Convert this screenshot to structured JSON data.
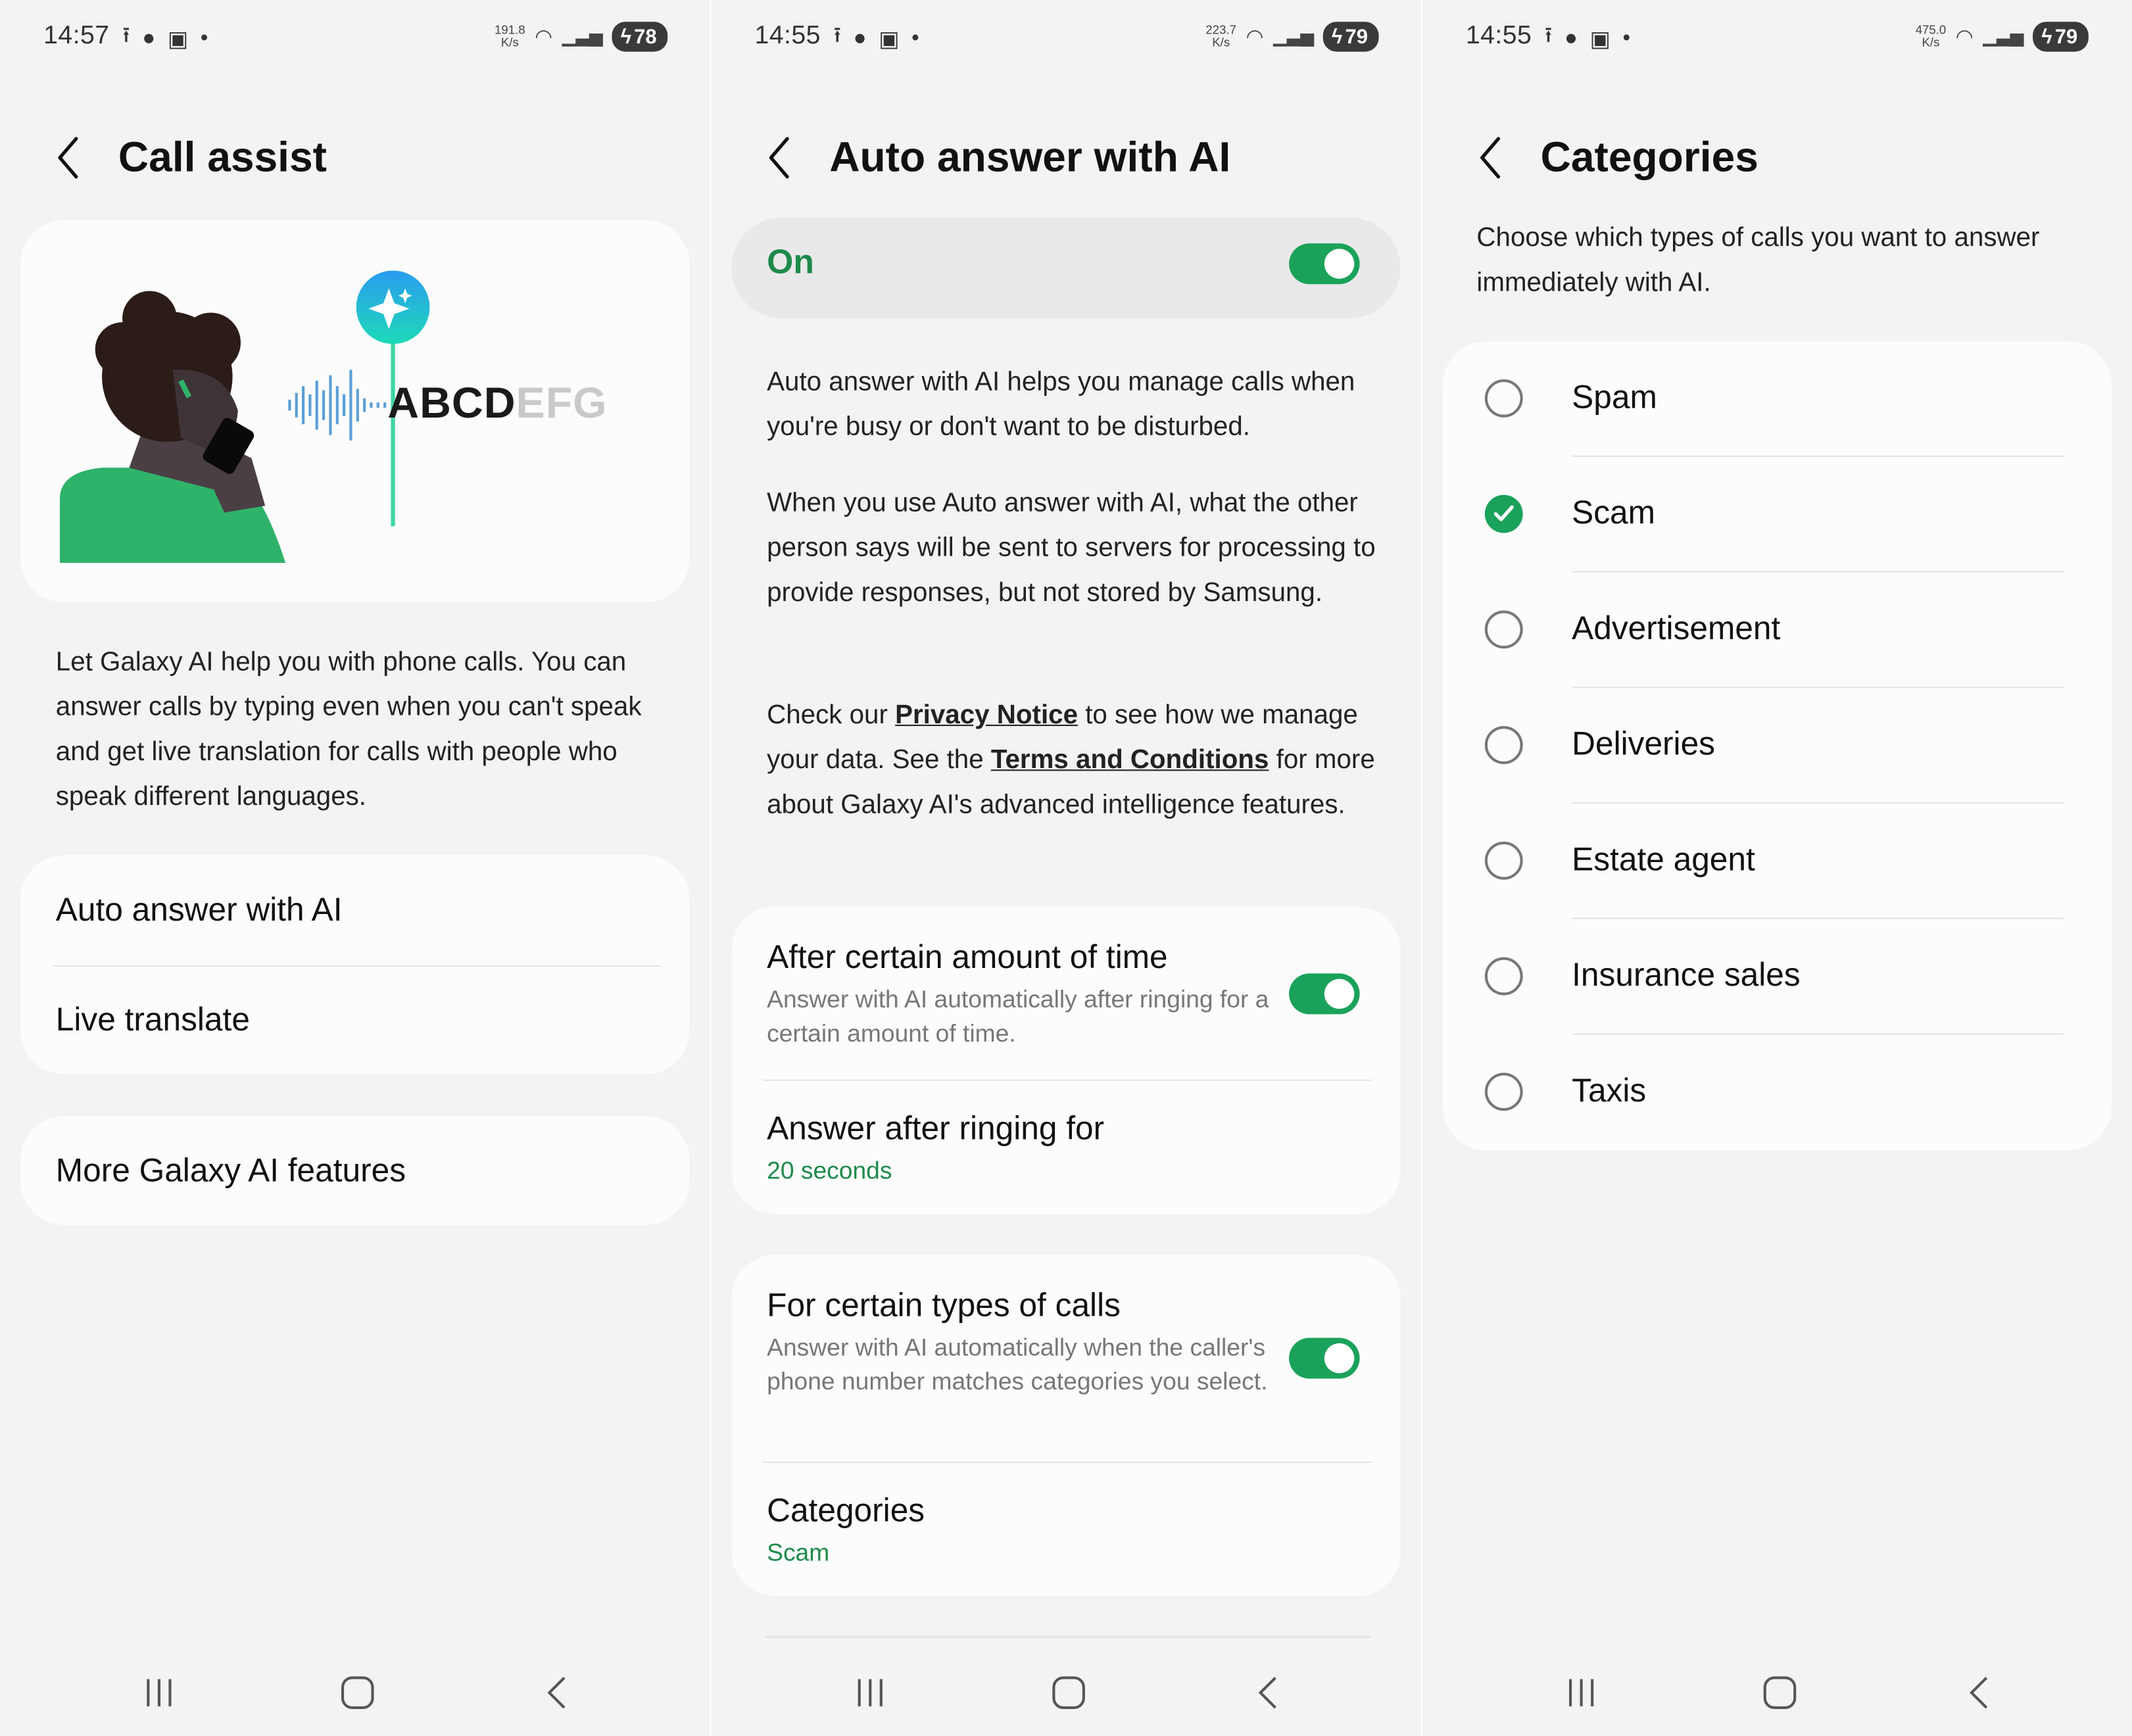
{
  "screens": [
    {
      "status": {
        "time": "14:57",
        "netspeed_value": "191.8",
        "netspeed_unit": "K/s",
        "battery": "78"
      },
      "title": "Call assist",
      "illustration": {
        "text_dark": "ABCD",
        "text_light": "EFG"
      },
      "description": "Let Galaxy AI help you with phone calls. You can answer calls by typing even when you can't speak and get live translation for calls with people who speak different languages.",
      "items": [
        "Auto answer with AI",
        "Live translate"
      ],
      "more": "More Galaxy AI features"
    },
    {
      "status": {
        "time": "14:55",
        "netspeed_value": "223.7",
        "netspeed_unit": "K/s",
        "battery": "79"
      },
      "title": "Auto answer with AI",
      "master_label": "On",
      "para1": "Auto answer with AI helps you manage calls when you're busy or don't want to be disturbed.",
      "para2": "When you use Auto answer with AI, what the other person says will be sent to servers for processing to provide responses, but not stored by Samsung.",
      "para3": {
        "pre": "Check our ",
        "link1": "Privacy Notice",
        "mid": " to see how we manage your data. See the ",
        "link2": "Terms and Conditions",
        "post": " for more about Galaxy AI's advanced intelligence features."
      },
      "time_option": {
        "title": "After certain amount of time",
        "subtitle": "Answer with AI automatically after ringing for a certain amount of time.",
        "ring_title": "Answer after ringing for",
        "ring_value": "20 seconds"
      },
      "type_option": {
        "title": "For certain types of calls",
        "subtitle": "Answer with AI automatically when the caller's phone number matches categories you select.",
        "categories_title": "Categories",
        "categories_value": "Scam"
      }
    },
    {
      "status": {
        "time": "14:55",
        "netspeed_value": "475.0",
        "netspeed_unit": "K/s",
        "battery": "79"
      },
      "title": "Categories",
      "intro": "Choose which types of calls you want to answer immediately with AI.",
      "categories": [
        {
          "label": "Spam",
          "checked": false
        },
        {
          "label": "Scam",
          "checked": true
        },
        {
          "label": "Advertisement",
          "checked": false
        },
        {
          "label": "Deliveries",
          "checked": false
        },
        {
          "label": "Estate agent",
          "checked": false
        },
        {
          "label": "Insurance sales",
          "checked": false
        },
        {
          "label": "Taxis",
          "checked": false
        }
      ]
    }
  ],
  "colors": {
    "accent": "#1aa25a",
    "accent_text": "#1e8a4c",
    "background": "#f3f3f3",
    "card": "#fcfcfc"
  }
}
